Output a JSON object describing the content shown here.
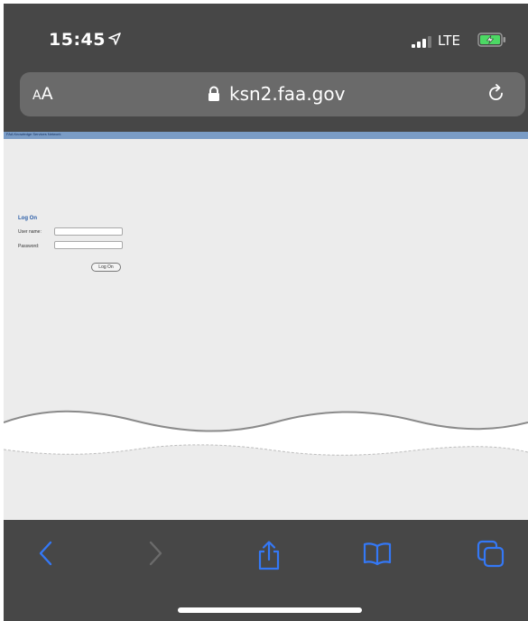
{
  "status_bar": {
    "time": "15:45",
    "network": "LTE",
    "icons": [
      "location-arrow-icon",
      "signal-bars-icon",
      "battery-charging-icon"
    ]
  },
  "url_bar": {
    "text_size_small": "A",
    "text_size_big": "A",
    "url": "ksn2.faa.gov",
    "icons": [
      "lock-icon",
      "reload-icon"
    ]
  },
  "page": {
    "site_name": "FAA Knowledge Services Network",
    "login": {
      "heading": "Log On",
      "username_label": "User name:",
      "password_label": "Password:",
      "button_label": "Log On"
    }
  },
  "toolbar": {
    "icons": [
      "back-chevron-icon",
      "forward-chevron-icon",
      "share-icon",
      "bookmarks-book-icon",
      "tabs-icon"
    ]
  },
  "colors": {
    "accent": "#3478f6",
    "chrome_background": "#474747",
    "url_bar_background": "#6a6a6a",
    "page_background": "#ececec",
    "site_header": "#7a9cc6",
    "login_heading": "#2b5ea8"
  }
}
